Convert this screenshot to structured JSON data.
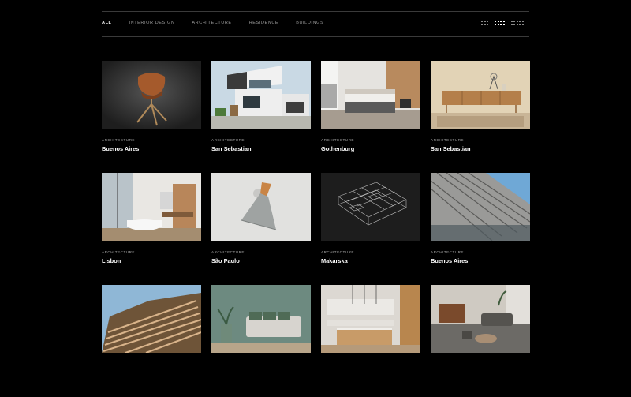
{
  "filters": [
    {
      "label": "ALL",
      "active": true
    },
    {
      "label": "INTERIOR DESIGN",
      "active": false
    },
    {
      "label": "ARCHITECTURE",
      "active": false
    },
    {
      "label": "RESIDENCE",
      "active": false
    },
    {
      "label": "BUILDINGS",
      "active": false
    }
  ],
  "view_modes": [
    "grid-3-icon",
    "grid-4-icon",
    "grid-5-icon"
  ],
  "active_view": "grid-4-icon",
  "projects": [
    {
      "category": "ARCHITECTURE",
      "city": "Buenos Aires",
      "image": "chair"
    },
    {
      "category": "ARCHITECTURE",
      "city": "San Sebastian",
      "image": "modern-house"
    },
    {
      "category": "ARCHITECTURE",
      "city": "Gothenburg",
      "image": "bedroom"
    },
    {
      "category": "ARCHITECTURE",
      "city": "San Sebastian",
      "image": "sideboard"
    },
    {
      "category": "ARCHITECTURE",
      "city": "Lisbon",
      "image": "bathroom"
    },
    {
      "category": "ARCHITECTURE",
      "city": "São Paulo",
      "image": "wall-lamp"
    },
    {
      "category": "ARCHITECTURE",
      "city": "Makarska",
      "image": "wireframe-plan"
    },
    {
      "category": "ARCHITECTURE",
      "city": "Buenos Aires",
      "image": "facade"
    },
    {
      "category": "",
      "city": "",
      "image": "wood-slats"
    },
    {
      "category": "",
      "city": "",
      "image": "living-room"
    },
    {
      "category": "",
      "city": "",
      "image": "kitchen"
    },
    {
      "category": "",
      "city": "",
      "image": "lounge"
    }
  ]
}
